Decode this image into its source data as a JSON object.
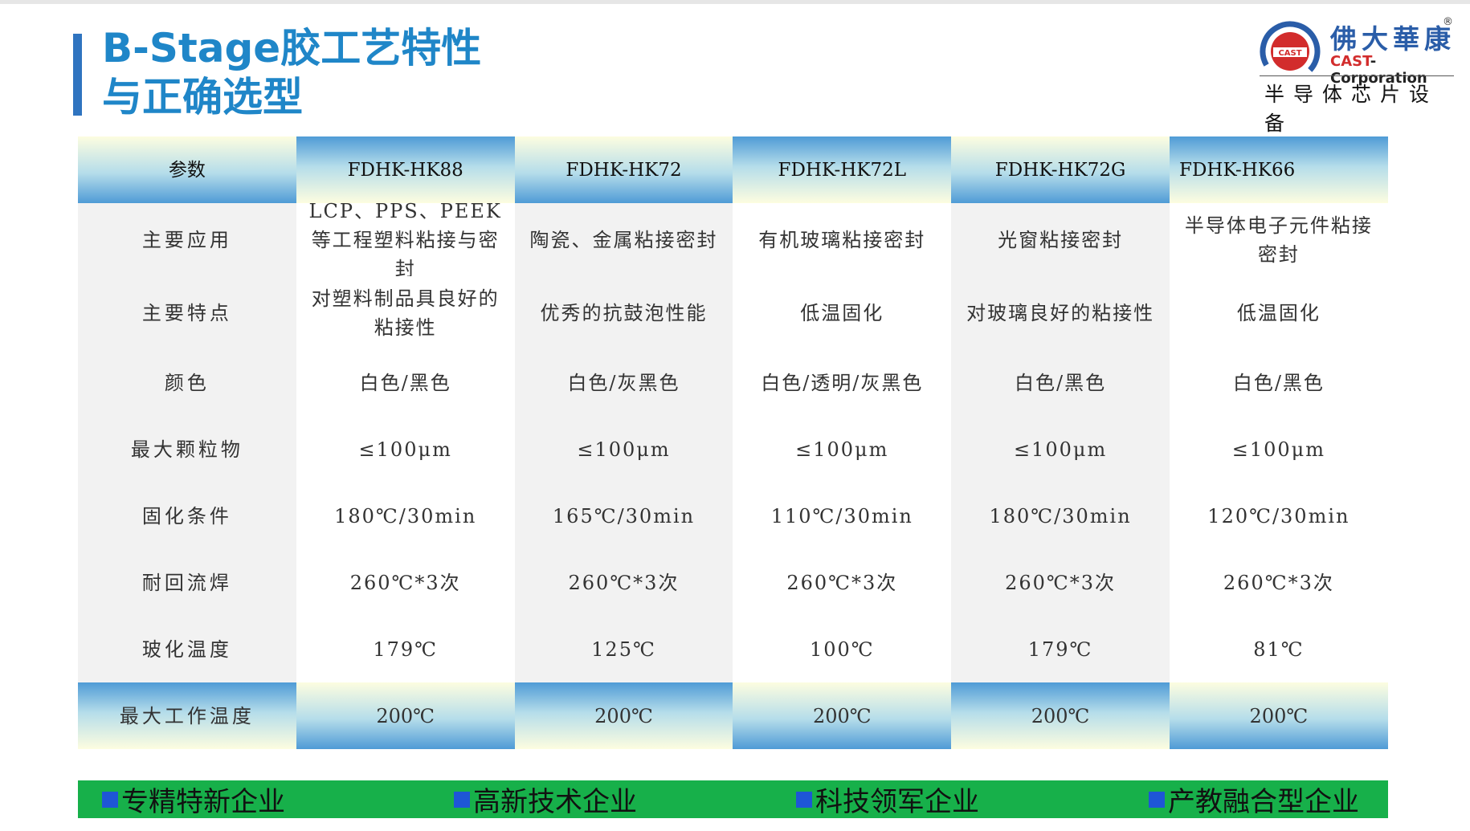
{
  "title": {
    "line1": "B-Stage胶工艺特性",
    "line2": "与正确选型"
  },
  "logo": {
    "name_cn": "佛大華康",
    "registered": "®",
    "name_en_prefix": "CAST",
    "name_en_suffix": "-Corporation",
    "emblem_text": "CAST",
    "subtitle": "半导体芯片设备",
    "colors": {
      "blue": "#2a5da8",
      "red": "#d22c2c"
    }
  },
  "table": {
    "header": [
      "参数",
      "FDHK-HK88",
      "FDHK-HK72",
      "FDHK-HK72L",
      "FDHK-HK72G",
      "FDHK-HK66"
    ],
    "rows": [
      {
        "param": "主要应用",
        "values": [
          "LCP、PPS、PEEK等工程塑料粘接与密封",
          "陶瓷、金属粘接密封",
          "有机玻璃粘接密封",
          "光窗粘接密封",
          "半导体电子元件粘接密封"
        ]
      },
      {
        "param": "主要特点",
        "values": [
          "对塑料制品具良好的粘接性",
          "优秀的抗鼓泡性能",
          "低温固化",
          "对玻璃良好的粘接性",
          "低温固化"
        ]
      },
      {
        "param": "颜色",
        "values": [
          "白色/黑色",
          "白色/灰黑色",
          "白色/透明/灰黑色",
          "白色/黑色",
          "白色/黑色"
        ]
      },
      {
        "param": "最大颗粒物",
        "values": [
          "≤100μm",
          "≤100μm",
          "≤100μm",
          "≤100μm",
          "≤100μm"
        ]
      },
      {
        "param": "固化条件",
        "values": [
          "180℃/30min",
          "165℃/30min",
          "110℃/30min",
          "180℃/30min",
          "120℃/30min"
        ]
      },
      {
        "param": "耐回流焊",
        "values": [
          "260℃*3次",
          "260℃*3次",
          "260℃*3次",
          "260℃*3次",
          "260℃*3次"
        ]
      },
      {
        "param": "玻化温度",
        "values": [
          "179℃",
          "125℃",
          "100℃",
          "179℃",
          "81℃"
        ]
      }
    ],
    "footer": {
      "param": "最大工作温度",
      "values": [
        "200℃",
        "200℃",
        "200℃",
        "200℃",
        "200℃"
      ]
    }
  },
  "banner": {
    "color": "#17b04a",
    "items": [
      "专精特新企业",
      "高新技术企业",
      "科技领军企业",
      "产教融合型企业"
    ]
  }
}
